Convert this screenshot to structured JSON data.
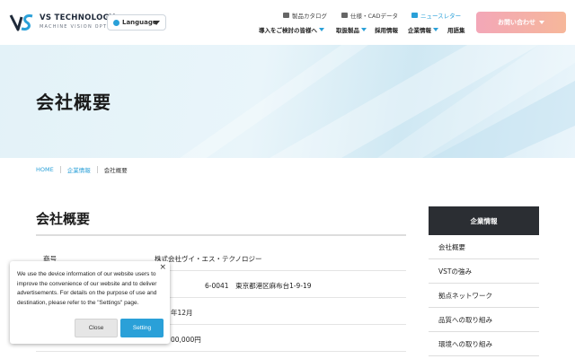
{
  "header": {
    "brand_name": "VS TECHNOLOGY",
    "brand_tagline": "MACHINE VISION OPTICS",
    "language_label": "Language",
    "utility_links": [
      {
        "label": "製品カタログ",
        "icon": "book-icon"
      },
      {
        "label": "仕様・CADデータ",
        "icon": "camera-icon"
      },
      {
        "label": "ニュースレター",
        "icon": "mail-icon"
      }
    ],
    "nav": [
      {
        "label": "導入をご検討の皆様へ",
        "dropdown": true
      },
      {
        "label": "取扱製品",
        "dropdown": true
      },
      {
        "label": "採用情報",
        "dropdown": false
      },
      {
        "label": "企業情報",
        "dropdown": true
      },
      {
        "label": "用語集",
        "dropdown": false
      }
    ],
    "contact_label": "お問い合わせ",
    "accent_color": "#2aa0d8"
  },
  "hero": {
    "title": "会社概要"
  },
  "breadcrumb": {
    "home": "HOME",
    "parent": "企業情報",
    "current": "会社概要"
  },
  "main": {
    "section_title": "会社概要",
    "rows": [
      {
        "key": "商号",
        "value": "株式会社ヴイ・エス・テクノロジー"
      },
      {
        "key": "",
        "value": "6-0041　東京都港区麻布台1-9-19"
      },
      {
        "key": "",
        "value": "年12月"
      },
      {
        "key": "",
        "value": "00,000円"
      }
    ]
  },
  "sidebar": {
    "heading": "企業情報",
    "items": [
      "会社概要",
      "VSTの強み",
      "拠点ネットワーク",
      "品質への取り組み",
      "環境への取り組み"
    ]
  },
  "cookie_popup": {
    "message": "We use the device information of our website users to improve the convenience of our website and to deliver advertisements. For details on the purpose of use and destination, please refer to the \"Settings\" page.",
    "close_label": "Close",
    "settings_label": "Setting",
    "dismiss_glyph": "×"
  }
}
